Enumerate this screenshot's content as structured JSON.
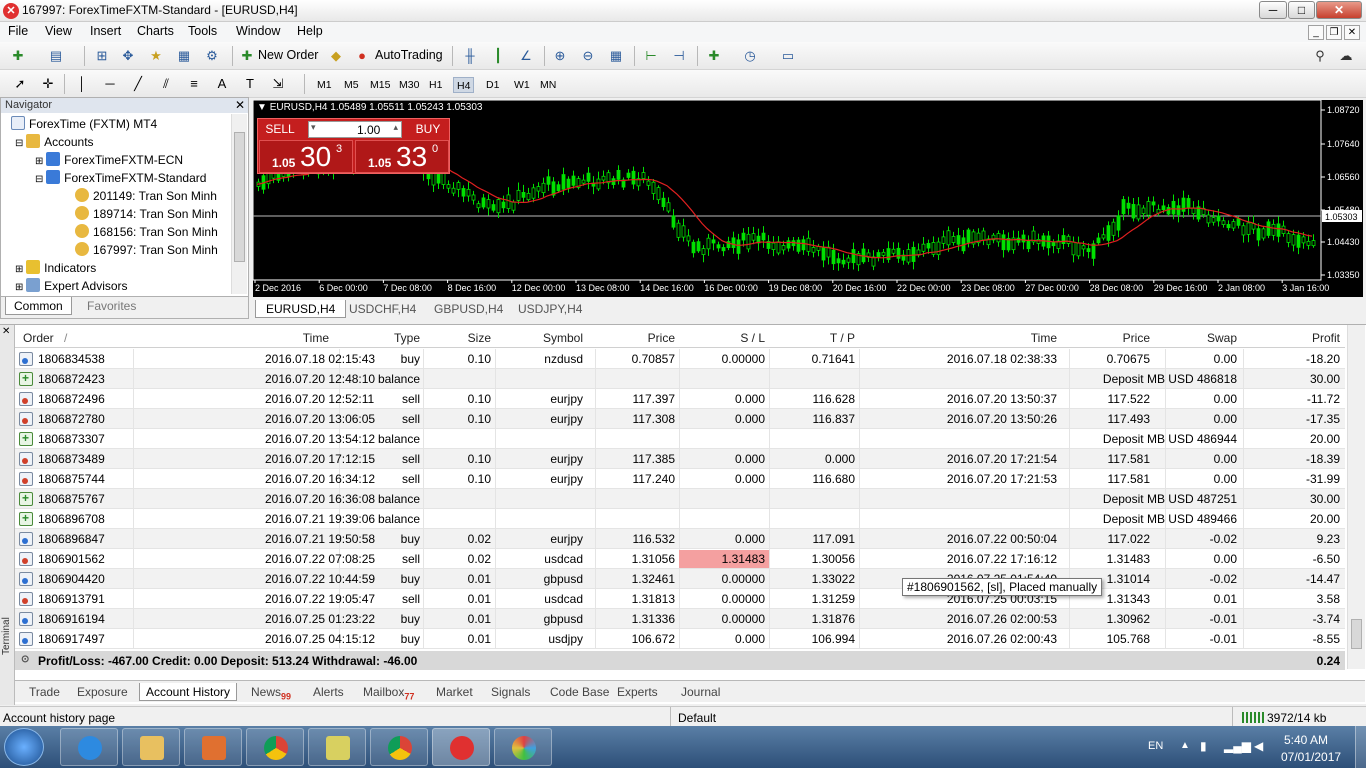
{
  "window": {
    "title": "167997: ForexTimeFXTM-Standard - [EURUSD,H4]",
    "min": "─",
    "max": "□",
    "close": "✕"
  },
  "menu": [
    "File",
    "View",
    "Insert",
    "Charts",
    "Tools",
    "Window",
    "Help"
  ],
  "toolbar": {
    "new_order": "New Order",
    "autotrading": "AutoTrading"
  },
  "timeframes": [
    "M1",
    "M5",
    "M15",
    "M30",
    "H1",
    "H4",
    "D1",
    "W1",
    "MN"
  ],
  "navigator": {
    "title": "Navigator",
    "broker": "ForexTime (FXTM) MT4",
    "accounts_label": "Accounts",
    "servers": [
      "ForexTimeFXTM-ECN",
      "ForexTimeFXTM-Standard"
    ],
    "accounts": [
      "201149: Tran Son Minh",
      "189714: Tran Son Minh",
      "168156: Tran Son Minh",
      "167997: Tran Son Minh"
    ],
    "indicators": "Indicators",
    "experts": "Expert Advisors",
    "tabs": [
      "Common",
      "Favorites"
    ]
  },
  "chart": {
    "header": "EURUSD,H4  1.05489 1.05511 1.05243 1.05303",
    "sell_label": "SELL",
    "buy_label": "BUY",
    "lot": "1.00",
    "sell_price_small": "1.05",
    "sell_price_big": "30",
    "sell_price_sup": "3",
    "buy_price_small": "1.05",
    "buy_price_big": "33",
    "buy_price_sup": "0",
    "price_axis": [
      "1.08720",
      "1.07640",
      "1.06560",
      "1.05480",
      "1.05303",
      "1.04430",
      "1.03350"
    ],
    "time_axis": [
      "2 Dec 2016",
      "6 Dec 00:00",
      "7 Dec 08:00",
      "8 Dec 16:00",
      "12 Dec 00:00",
      "13 Dec 08:00",
      "14 Dec 16:00",
      "16 Dec 00:00",
      "19 Dec 08:00",
      "20 Dec 16:00",
      "22 Dec 00:00",
      "23 Dec 08:00",
      "27 Dec 00:00",
      "28 Dec 08:00",
      "29 Dec 16:00",
      "2 Jan 08:00",
      "3 Jan 16:00"
    ],
    "current_price": "1.05303",
    "colors": {
      "bull": "#00e000",
      "bear": "#000000",
      "ma": "#e02020"
    },
    "tabs": [
      "EURUSD,H4",
      "USDCHF,H4",
      "GBPUSD,H4",
      "USDJPY,H4"
    ]
  },
  "terminal": {
    "side_label": "Terminal",
    "columns": [
      "Order",
      "/",
      "Time",
      "Type",
      "Size",
      "Symbol",
      "Price",
      "S / L",
      "T / P",
      "Time",
      "Price",
      "Swap",
      "Profit"
    ],
    "rows": [
      {
        "icon": "buy",
        "order": "1806834538",
        "time": "2016.07.18 02:15:43",
        "type": "buy",
        "size": "0.10",
        "symbol": "nzdusd",
        "price": "0.70857",
        "sl": "0.00000",
        "tp": "0.71641",
        "ctime": "2016.07.18 02:38:33",
        "cprice": "0.70675",
        "swap": "0.00",
        "profit": "-18.20"
      },
      {
        "icon": "balance",
        "order": "1806872423",
        "time": "2016.07.20 12:48:10",
        "type": "balance",
        "comment": "Deposit MB USD 486818",
        "profit": "30.00"
      },
      {
        "icon": "sell",
        "order": "1806872496",
        "time": "2016.07.20 12:52:11",
        "type": "sell",
        "size": "0.10",
        "symbol": "eurjpy",
        "price": "117.397",
        "sl": "0.000",
        "tp": "116.628",
        "ctime": "2016.07.20 13:50:37",
        "cprice": "117.522",
        "swap": "0.00",
        "profit": "-11.72"
      },
      {
        "icon": "sell",
        "order": "1806872780",
        "time": "2016.07.20 13:06:05",
        "type": "sell",
        "size": "0.10",
        "symbol": "eurjpy",
        "price": "117.308",
        "sl": "0.000",
        "tp": "116.837",
        "ctime": "2016.07.20 13:50:26",
        "cprice": "117.493",
        "swap": "0.00",
        "profit": "-17.35"
      },
      {
        "icon": "balance",
        "order": "1806873307",
        "time": "2016.07.20 13:54:12",
        "type": "balance",
        "comment": "Deposit MB USD 486944",
        "profit": "20.00"
      },
      {
        "icon": "sell",
        "order": "1806873489",
        "time": "2016.07.20 17:12:15",
        "type": "sell",
        "size": "0.10",
        "symbol": "eurjpy",
        "price": "117.385",
        "sl": "0.000",
        "tp": "0.000",
        "ctime": "2016.07.20 17:21:54",
        "cprice": "117.581",
        "swap": "0.00",
        "profit": "-18.39"
      },
      {
        "icon": "sell",
        "order": "1806875744",
        "time": "2016.07.20 16:34:12",
        "type": "sell",
        "size": "0.10",
        "symbol": "eurjpy",
        "price": "117.240",
        "sl": "0.000",
        "tp": "116.680",
        "ctime": "2016.07.20 17:21:53",
        "cprice": "117.581",
        "swap": "0.00",
        "profit": "-31.99"
      },
      {
        "icon": "balance",
        "order": "1806875767",
        "time": "2016.07.20 16:36:08",
        "type": "balance",
        "comment": "Deposit MB USD 487251",
        "profit": "30.00"
      },
      {
        "icon": "balance",
        "order": "1806896708",
        "time": "2016.07.21 19:39:06",
        "type": "balance",
        "comment": "Deposit MB USD 489466",
        "profit": "20.00"
      },
      {
        "icon": "buy",
        "order": "1806896847",
        "time": "2016.07.21 19:50:58",
        "type": "buy",
        "size": "0.02",
        "symbol": "eurjpy",
        "price": "116.532",
        "sl": "0.000",
        "tp": "117.091",
        "ctime": "2016.07.22 00:50:04",
        "cprice": "117.022",
        "swap": "-0.02",
        "profit": "9.23"
      },
      {
        "icon": "sell",
        "order": "1806901562",
        "time": "2016.07.22 07:08:25",
        "type": "sell",
        "size": "0.02",
        "symbol": "usdcad",
        "price": "1.31056",
        "sl": "1.31483",
        "tp": "1.30056",
        "ctime": "2016.07.22 17:16:12",
        "cprice": "1.31483",
        "swap": "0.00",
        "profit": "-6.50",
        "sl_hit": true
      },
      {
        "icon": "buy",
        "order": "1806904420",
        "time": "2016.07.22 10:44:59",
        "type": "buy",
        "size": "0.01",
        "symbol": "gbpusd",
        "price": "1.32461",
        "sl": "0.00000",
        "tp": "1.33022",
        "ctime": "2016.07.25 01:54:49",
        "cprice": "1.31014",
        "swap": "-0.02",
        "profit": "-14.47"
      },
      {
        "icon": "sell",
        "order": "1806913791",
        "time": "2016.07.22 19:05:47",
        "type": "sell",
        "size": "0.01",
        "symbol": "usdcad",
        "price": "1.31813",
        "sl": "0.00000",
        "tp": "1.31259",
        "ctime": "2016.07.25 00:03:15",
        "cprice": "1.31343",
        "swap": "0.01",
        "profit": "3.58"
      },
      {
        "icon": "buy",
        "order": "1806916194",
        "time": "2016.07.25 01:23:22",
        "type": "buy",
        "size": "0.01",
        "symbol": "gbpusd",
        "price": "1.31336",
        "sl": "0.00000",
        "tp": "1.31876",
        "ctime": "2016.07.26 02:00:53",
        "cprice": "1.30962",
        "swap": "-0.01",
        "profit": "-3.74"
      },
      {
        "icon": "buy",
        "order": "1806917497",
        "time": "2016.07.25 04:15:12",
        "type": "buy",
        "size": "0.01",
        "symbol": "usdjpy",
        "price": "106.672",
        "sl": "0.000",
        "tp": "106.994",
        "ctime": "2016.07.26 02:00:43",
        "cprice": "105.768",
        "swap": "-0.01",
        "profit": "-8.55"
      }
    ],
    "summary": "Profit/Loss: -467.00  Credit: 0.00  Deposit: 513.24  Withdrawal: -46.00",
    "summary_total": "0.24",
    "tooltip": "#1806901562, [sl], Placed manually",
    "tabs": [
      {
        "label": "Trade"
      },
      {
        "label": "Exposure"
      },
      {
        "label": "Account History",
        "active": true
      },
      {
        "label": "News",
        "badge": "99"
      },
      {
        "label": "Alerts"
      },
      {
        "label": "Mailbox",
        "badge": "77"
      },
      {
        "label": "Market"
      },
      {
        "label": "Signals"
      },
      {
        "label": "Code Base"
      },
      {
        "label": "Experts"
      },
      {
        "label": "Journal"
      }
    ]
  },
  "status": {
    "left": "Account history page",
    "profile": "Default",
    "traffic": "3972/14 kb"
  },
  "taskbar": {
    "lang": "EN",
    "time": "5:40 AM",
    "date": "07/01/2017"
  }
}
